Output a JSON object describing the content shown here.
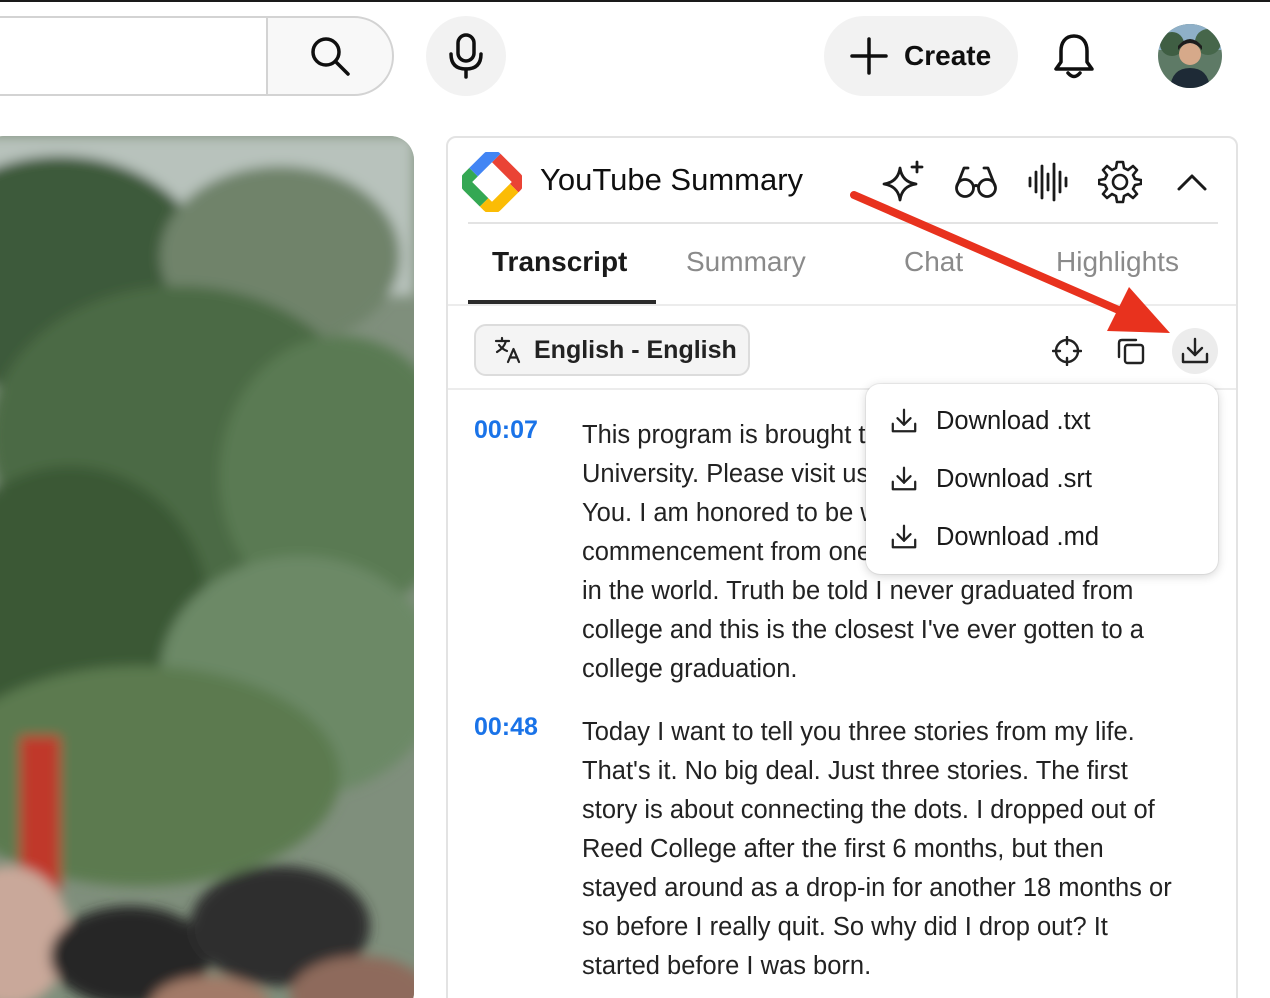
{
  "header": {
    "create_label": "Create"
  },
  "panel": {
    "title": "YouTube Summary",
    "tabs": [
      {
        "label": "Transcript",
        "active": true
      },
      {
        "label": "Summary",
        "active": false
      },
      {
        "label": "Chat",
        "active": false
      },
      {
        "label": "Highlights",
        "active": false
      }
    ],
    "language_chip": "English - English",
    "transcript": [
      {
        "time": "00:07",
        "lines": [
          "This program is brought to you by Stanford",
          "University. Please visit us at stanford.edu. Thank",
          "You. I am honored to be with you today at your",
          "commencement from one of the finest universities",
          "in the world. Truth be told I never graduated from",
          "college and this is the closest I've ever gotten to a",
          "college graduation."
        ]
      },
      {
        "time": "00:48",
        "lines": [
          "Today I want to tell you three stories from my life.",
          "That's it. No big deal. Just three stories. The first",
          "story is about connecting the dots. I dropped out of",
          "Reed College after the first 6 months, but then",
          "stayed around as a drop-in for another 18 months or",
          "so before I really quit. So why did I drop out? It",
          "started before I was born."
        ]
      }
    ]
  },
  "download_menu": {
    "items": [
      "Download .txt",
      "Download .srt",
      "Download .md"
    ]
  },
  "colors": {
    "accent_timestamp": "#1a73e8",
    "annotation_arrow": "#e8321e"
  },
  "icons": [
    "search-icon",
    "microphone-icon",
    "plus-icon",
    "bell-icon",
    "sparkle-icon",
    "glasses-icon",
    "audio-wave-icon",
    "gear-icon",
    "chevron-up-icon",
    "translate-icon",
    "crosshair-icon",
    "copy-icon",
    "download-icon"
  ]
}
